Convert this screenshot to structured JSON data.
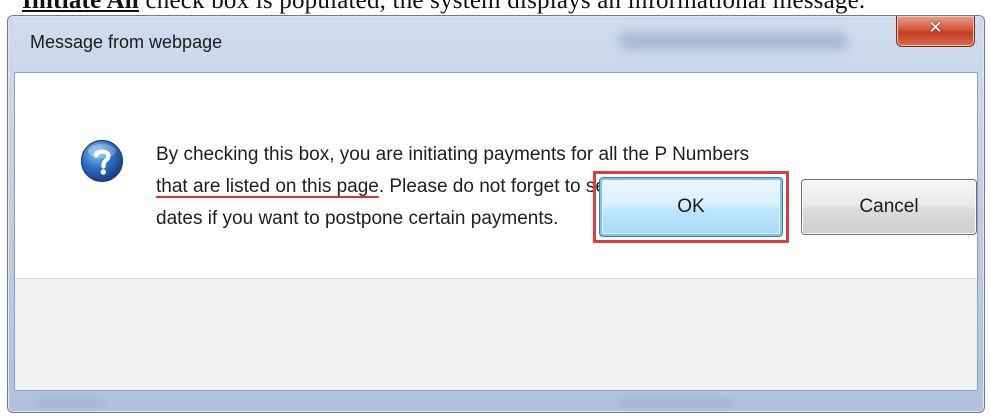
{
  "document": {
    "underlined_text": "Initiate All",
    "rest_text": " check box is populated, the system displays an informational message."
  },
  "dialog": {
    "title": "Message from webpage",
    "close_glyph": "✕",
    "icon": "question-icon",
    "message": {
      "line1": "By checking this box, you are initiating payments for all the P Numbers",
      "line2_underlined": "that are listed on this page",
      "line2_rest": ". Please do not forget to set the payment",
      "line3": "dates if you want to postpone certain payments."
    },
    "buttons": {
      "ok_label": "OK",
      "cancel_label": "Cancel"
    }
  },
  "colors": {
    "highlight": "#e53a3a",
    "underline": "#e03030",
    "close_button": "#c13e21",
    "icon_blue": "#2a5fa8"
  }
}
